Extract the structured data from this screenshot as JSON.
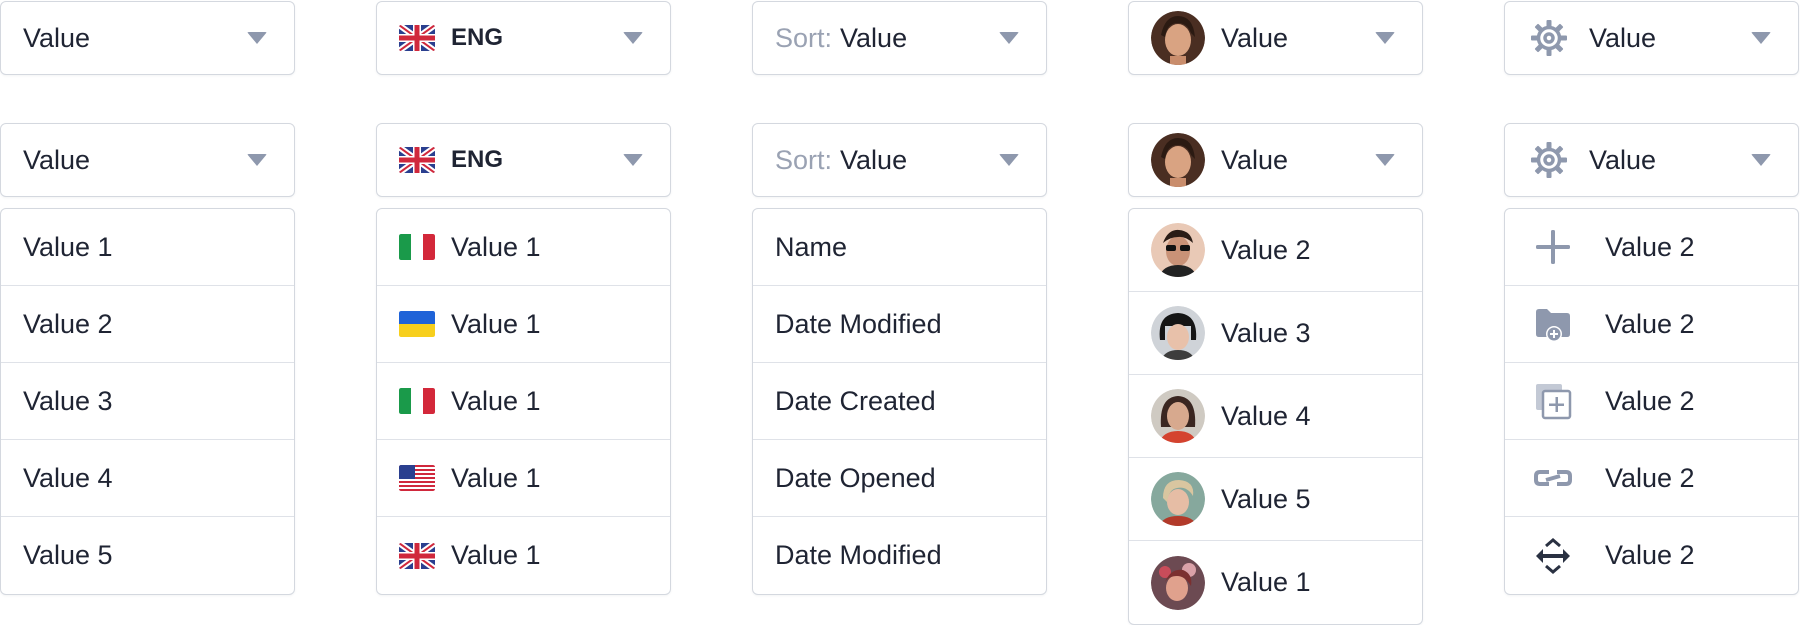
{
  "colors": {
    "border": "#d4d8df",
    "text": "#1f2433",
    "muted": "#9aa2b3",
    "icon": "#8e98ad"
  },
  "basic": {
    "closed_value": "Value",
    "open_value": "Value",
    "options": [
      "Value 1",
      "Value 2",
      "Value 3",
      "Value 4",
      "Value 5"
    ]
  },
  "language": {
    "closed_value": "ENG",
    "closed_flag": "uk-flag-icon",
    "open_value": "ENG",
    "options": [
      {
        "flag": "italy-flag-icon",
        "label": "Value 1"
      },
      {
        "flag": "ukraine-flag-icon",
        "label": "Value 1"
      },
      {
        "flag": "italy-flag-icon",
        "label": "Value 1"
      },
      {
        "flag": "usa-flag-icon",
        "label": "Value 1"
      },
      {
        "flag": "uk-flag-icon",
        "label": "Value 1"
      }
    ]
  },
  "sort": {
    "prefix": "Sort:",
    "closed_value": "Value",
    "open_value": "Value",
    "options": [
      "Name",
      "Date Modified",
      "Date Created",
      "Date Opened",
      "Date Modified"
    ]
  },
  "user": {
    "closed_value": "Value",
    "open_value": "Value",
    "options": [
      {
        "avatar": "avatar-man-sunglasses",
        "label": "Value 2"
      },
      {
        "avatar": "avatar-woman-dark-bob",
        "label": "Value 3"
      },
      {
        "avatar": "avatar-woman-red-top",
        "label": "Value 4"
      },
      {
        "avatar": "avatar-woman-blonde",
        "label": "Value 5"
      },
      {
        "avatar": "avatar-woman-headphones",
        "label": "Value 1"
      }
    ]
  },
  "settings": {
    "icon": "gear-icon",
    "closed_value": "Value",
    "open_value": "Value",
    "options": [
      {
        "icon": "plus-icon",
        "label": "Value 2"
      },
      {
        "icon": "folder-add-icon",
        "label": "Value 2"
      },
      {
        "icon": "duplicate-icon",
        "label": "Value 2"
      },
      {
        "icon": "link-icon",
        "label": "Value 2"
      },
      {
        "icon": "move-icon",
        "label": "Value 2"
      }
    ]
  }
}
